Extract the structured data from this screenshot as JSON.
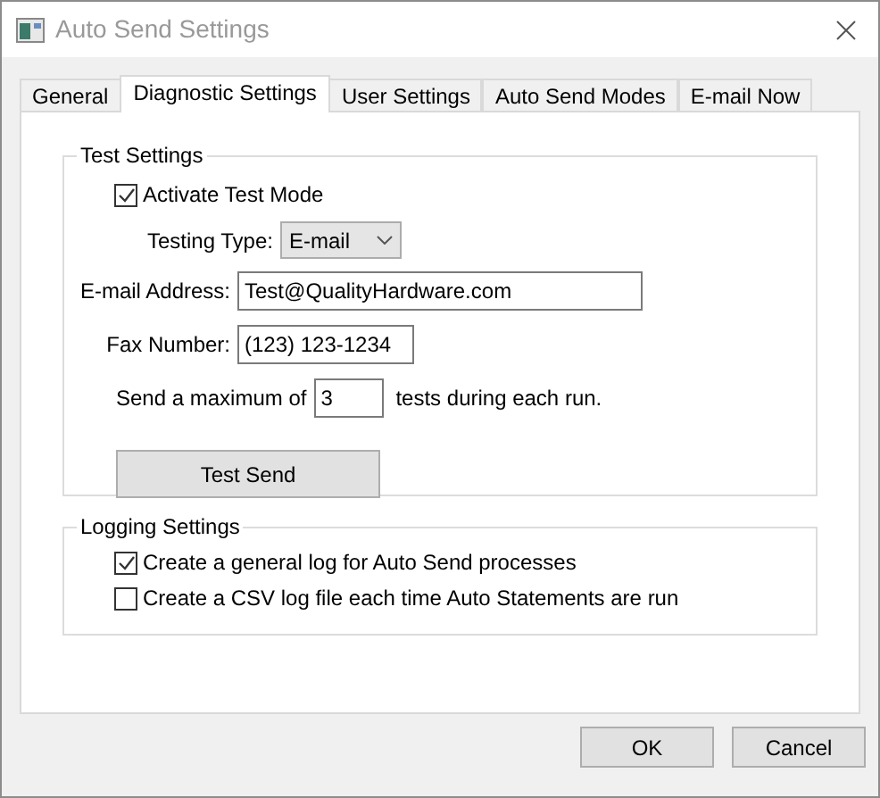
{
  "window": {
    "title": "Auto Send Settings"
  },
  "tabs": [
    {
      "label": "General",
      "selected": false
    },
    {
      "label": "Diagnostic Settings",
      "selected": true
    },
    {
      "label": "User Settings",
      "selected": false
    },
    {
      "label": "Auto Send Modes",
      "selected": false
    },
    {
      "label": "E-mail Now",
      "selected": false
    }
  ],
  "test_settings": {
    "title": "Test Settings",
    "activate": {
      "label": "Activate Test Mode",
      "checked": true
    },
    "testing_type": {
      "label": "Testing Type:",
      "value": "E-mail"
    },
    "email": {
      "label": "E-mail Address:",
      "value": "Test@QualityHardware.com"
    },
    "fax": {
      "label": "Fax Number:",
      "value": "(123) 123-1234"
    },
    "maximum": {
      "before": "Send a maximum of",
      "value": "3",
      "after": "tests during each run."
    },
    "test_button": "Test Send"
  },
  "logging_settings": {
    "title": "Logging Settings",
    "options": [
      {
        "label": "Create a general log for Auto Send processes",
        "checked": true
      },
      {
        "label": "Create a CSV log file each time Auto Statements are run",
        "checked": false
      }
    ]
  },
  "buttons": [
    "OK",
    "Cancel"
  ]
}
